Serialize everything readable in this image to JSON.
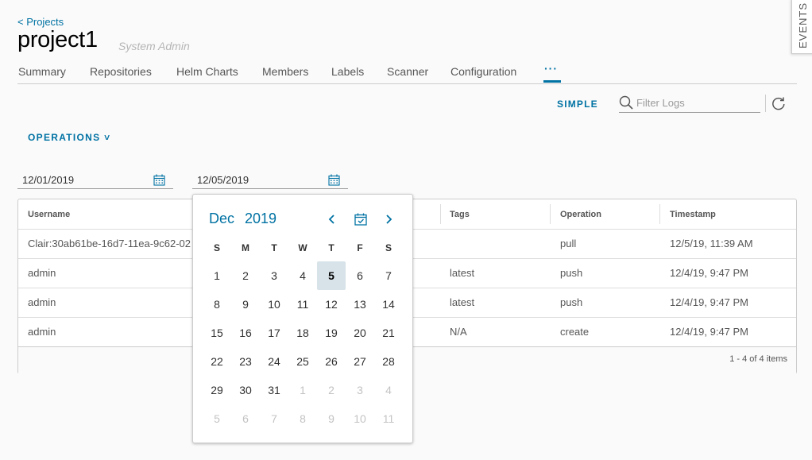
{
  "header": {
    "back_link": "< Projects",
    "title": "project1",
    "role": "System Admin"
  },
  "events_tab": {
    "label": "EVENTS"
  },
  "tabs": [
    {
      "label": "Summary"
    },
    {
      "label": "Repositories"
    },
    {
      "label": "Helm Charts"
    },
    {
      "label": "Members"
    },
    {
      "label": "Labels"
    },
    {
      "label": "Scanner"
    },
    {
      "label": "Configuration"
    },
    {
      "label": "···",
      "active": true
    }
  ],
  "toolbar": {
    "simple_label": "SIMPLE",
    "search_placeholder": "Filter Logs",
    "search_value": "",
    "refresh_icon": "refresh-icon"
  },
  "operations": {
    "label": "OPERATIONS ˅"
  },
  "date_range": {
    "from": "12/01/2019",
    "to": "12/05/2019"
  },
  "table": {
    "columns": [
      "Username",
      "Tags",
      "Operation",
      "Timestamp"
    ],
    "rows": [
      {
        "username": "Clair:30ab61be-16d7-11ea-9c62-02",
        "tags": "",
        "operation": "pull",
        "timestamp": "12/5/19, 11:39 AM"
      },
      {
        "username": "admin",
        "tags": "latest",
        "operation": "push",
        "timestamp": "12/4/19, 9:47 PM"
      },
      {
        "username": "admin",
        "tags": "latest",
        "operation": "push",
        "timestamp": "12/4/19, 9:47 PM"
      },
      {
        "username": "admin",
        "tags": "N/A",
        "operation": "create",
        "timestamp": "12/4/19, 9:47 PM"
      }
    ],
    "pagination": "1 - 4 of 4 items"
  },
  "calendar": {
    "month": "Dec",
    "year": "2019",
    "weekdays": [
      "S",
      "M",
      "T",
      "W",
      "T",
      "F",
      "S"
    ],
    "days": [
      "1",
      "2",
      "3",
      "4",
      "5",
      "6",
      "7",
      "8",
      "9",
      "10",
      "11",
      "12",
      "13",
      "14",
      "15",
      "16",
      "17",
      "18",
      "19",
      "20",
      "21",
      "22",
      "23",
      "24",
      "25",
      "26",
      "27",
      "28",
      "29",
      "30",
      "31",
      "1",
      "2",
      "3",
      "4",
      "5",
      "6",
      "7",
      "8",
      "9",
      "10",
      "11"
    ],
    "selected_day": "5",
    "accent_color": "#0072a3"
  }
}
